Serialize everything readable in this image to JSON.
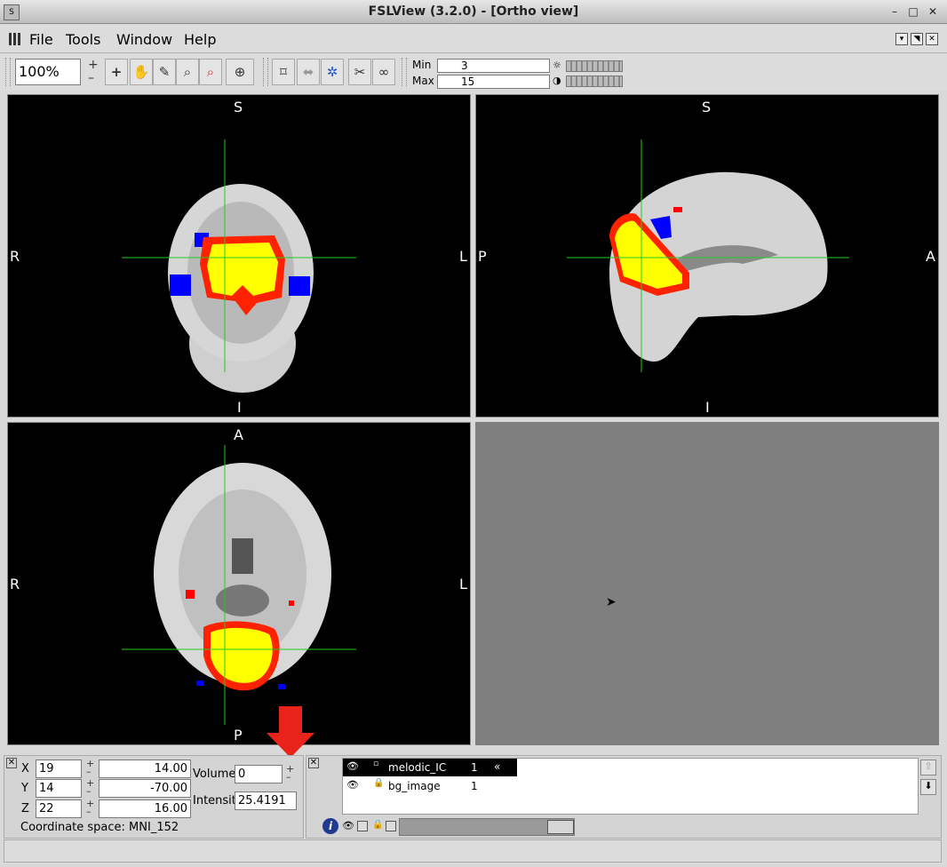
{
  "window": {
    "title": "FSLView (3.2.0) - [Ortho view]",
    "icon": "app-icon",
    "controls": [
      "–",
      "□",
      "✕"
    ]
  },
  "menu": [
    "File",
    "Tools",
    "Window",
    "Help"
  ],
  "toolbar": {
    "zoom": "100%",
    "plus": "+",
    "minus": "–",
    "min_label": "Min",
    "min_value": "3",
    "max_label": "Max",
    "max_value": "15",
    "tools": [
      "crosshair-icon",
      "hand-icon",
      "pencil-icon",
      "zoom-in-icon",
      "zoom-out-icon",
      "cursor-target-icon"
    ],
    "view_tools": [
      "toggle-cursor-icon",
      "fill-icon",
      "link-icon",
      "cut-icon",
      "binoculars-icon"
    ]
  },
  "views": {
    "coronal": {
      "top": "S",
      "bottom": "I",
      "left": "R",
      "right": "L"
    },
    "sagittal": {
      "top": "S",
      "bottom": "I",
      "left": "P",
      "right": "A"
    },
    "axial": {
      "top": "A",
      "bottom": "P",
      "left": "R",
      "right": "L"
    }
  },
  "cursor": {
    "x_label": "X",
    "x_voxel": "19",
    "x_mm": "14.00",
    "y_label": "Y",
    "y_voxel": "14",
    "y_mm": "-70.00",
    "z_label": "Z",
    "z_voxel": "22",
    "z_mm": "16.00",
    "volume_label": "Volume",
    "volume_value": "0",
    "intensity_label": "Intensity",
    "intensity_value": "25.4191",
    "coordinate_space": "Coordinate space: MNI_152"
  },
  "layers": [
    {
      "name": "melodic_IC",
      "value": "1",
      "selected": true
    },
    {
      "name": "bg_image",
      "value": "1",
      "selected": false
    }
  ],
  "colors": {
    "activation_hot": "#ffff00",
    "activation_edge": "#ff0000",
    "activation_neg": "#0000ff",
    "crosshair": "#22cc22",
    "annotation_arrow": "#e8231c"
  }
}
